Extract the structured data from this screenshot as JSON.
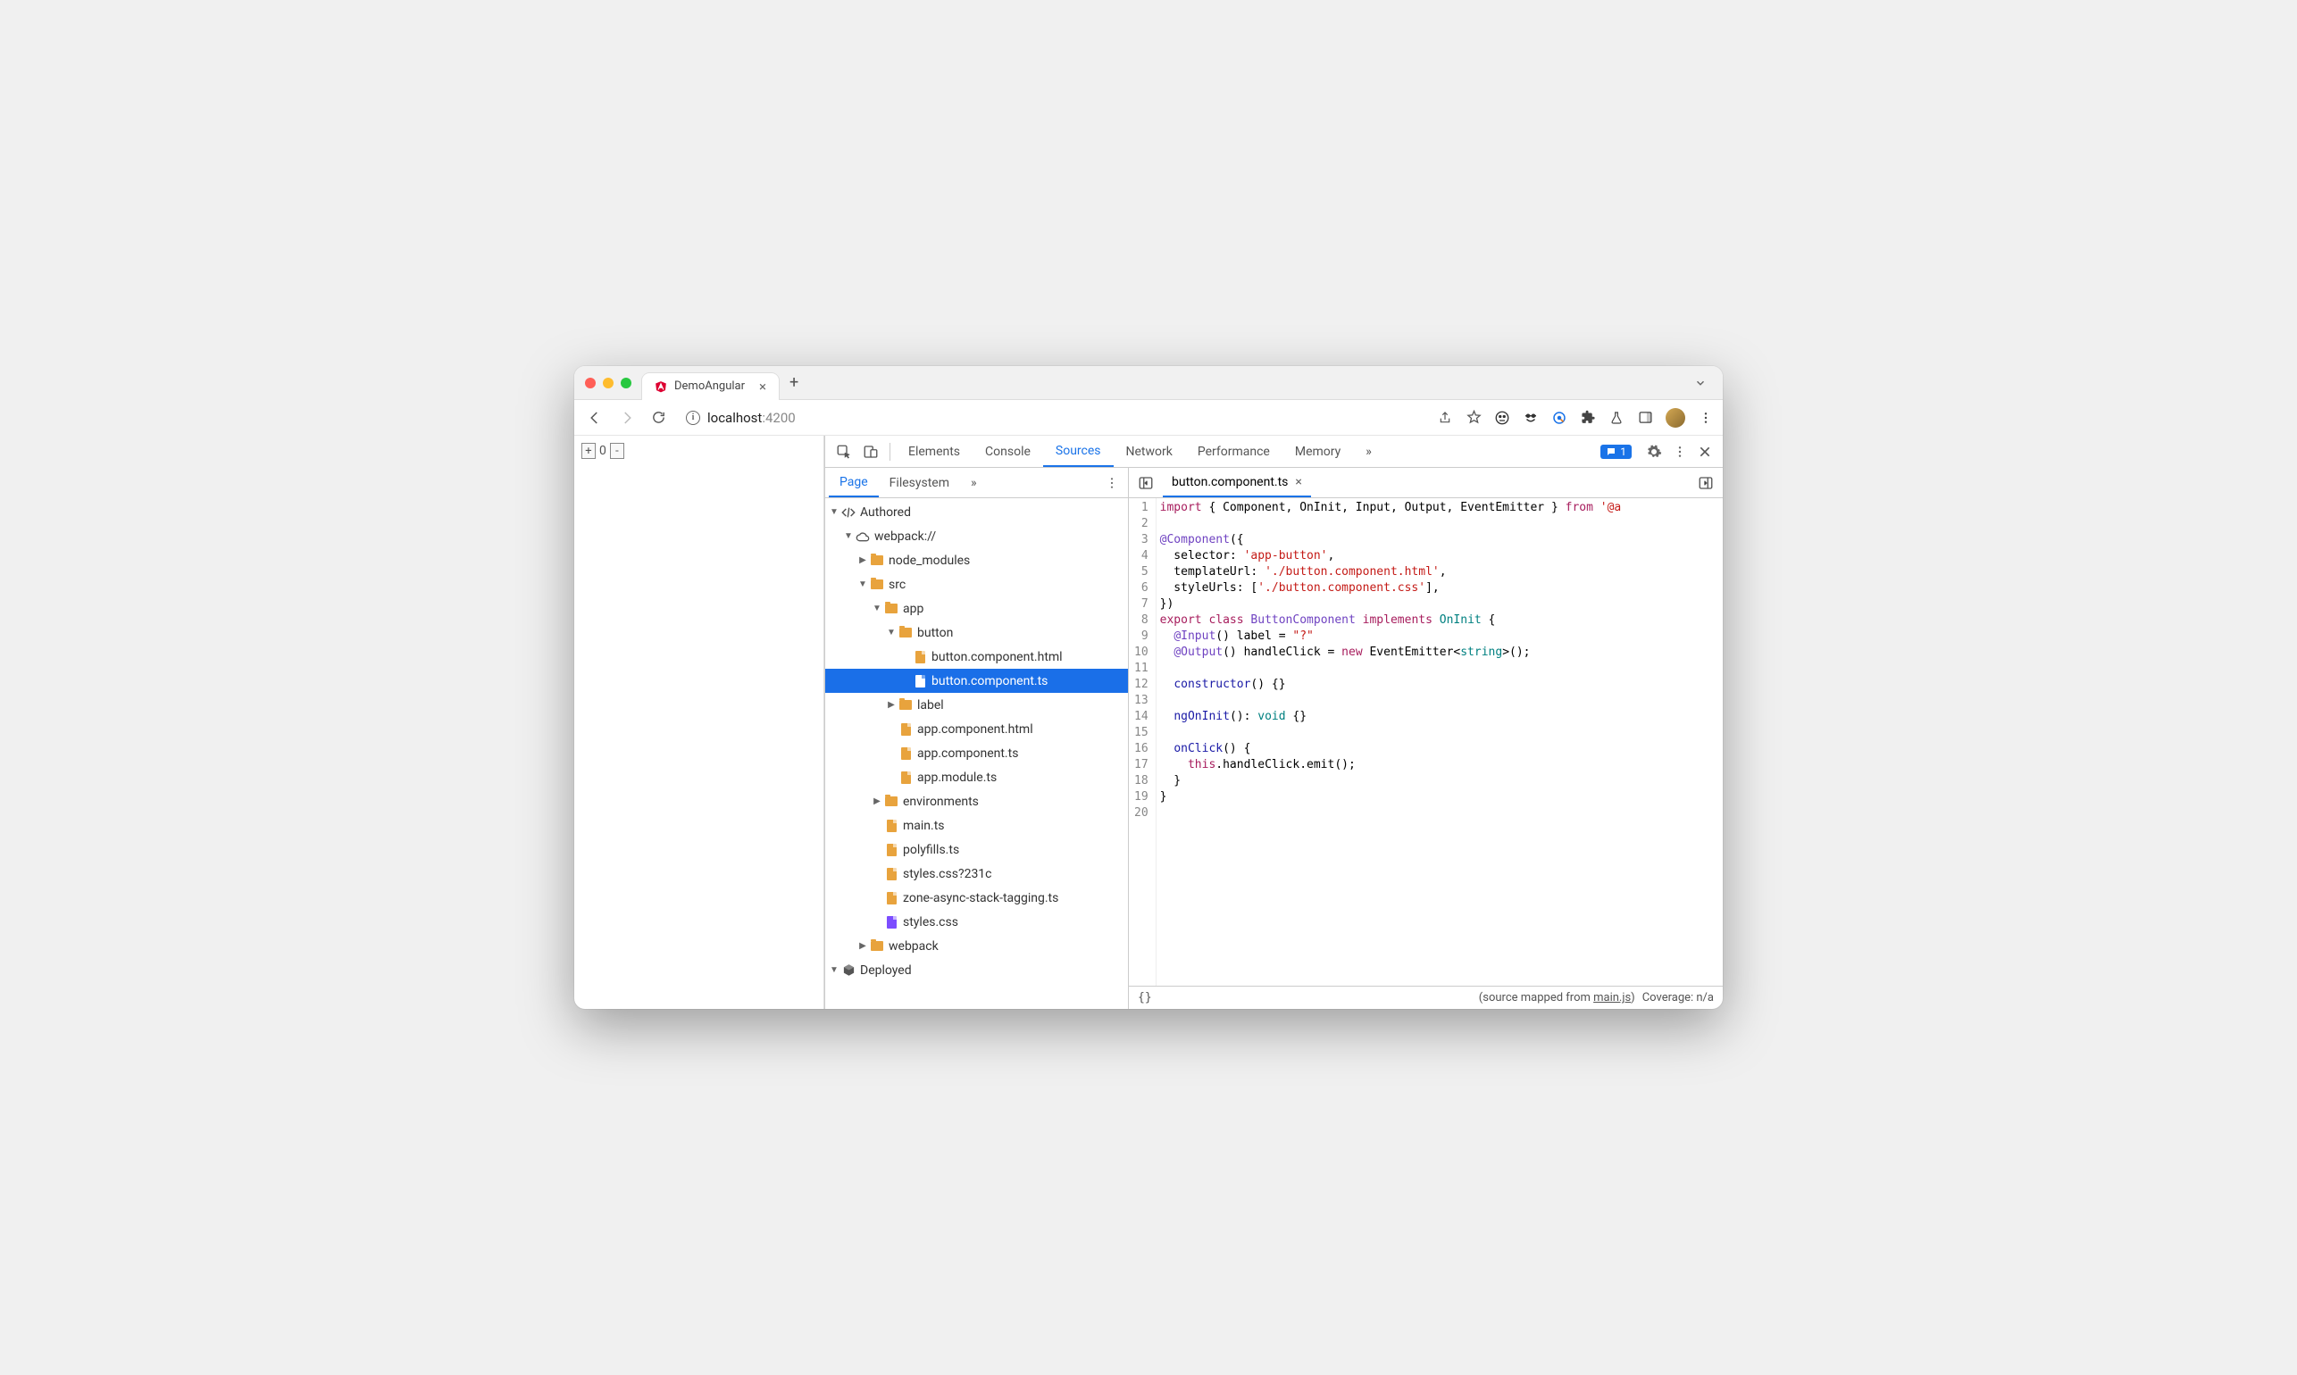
{
  "tab": {
    "title": "DemoAngular"
  },
  "url": {
    "host": "localhost",
    "port": ":4200"
  },
  "counter": {
    "plus": "+",
    "value": "0",
    "minus": "-"
  },
  "devtools": {
    "tabs": [
      "Elements",
      "Console",
      "Sources",
      "Network",
      "Performance",
      "Memory"
    ],
    "more": "»",
    "msg_count": "1"
  },
  "sources": {
    "tabs": [
      "Page",
      "Filesystem"
    ],
    "more": "»"
  },
  "tree": [
    {
      "depth": 0,
      "arrow": "▼",
      "icon": "code",
      "label": "Authored"
    },
    {
      "depth": 1,
      "arrow": "▼",
      "icon": "cloud",
      "label": "webpack://"
    },
    {
      "depth": 2,
      "arrow": "▶",
      "icon": "folder",
      "label": "node_modules"
    },
    {
      "depth": 2,
      "arrow": "▼",
      "icon": "folder",
      "label": "src"
    },
    {
      "depth": 3,
      "arrow": "▼",
      "icon": "folder",
      "label": "app"
    },
    {
      "depth": 4,
      "arrow": "▼",
      "icon": "folder",
      "label": "button"
    },
    {
      "depth": 5,
      "arrow": "",
      "icon": "file",
      "label": "button.component.html"
    },
    {
      "depth": 5,
      "arrow": "",
      "icon": "file",
      "label": "button.component.ts",
      "selected": true
    },
    {
      "depth": 4,
      "arrow": "▶",
      "icon": "folder",
      "label": "label"
    },
    {
      "depth": 4,
      "arrow": "",
      "icon": "file",
      "label": "app.component.html"
    },
    {
      "depth": 4,
      "arrow": "",
      "icon": "file",
      "label": "app.component.ts"
    },
    {
      "depth": 4,
      "arrow": "",
      "icon": "file",
      "label": "app.module.ts"
    },
    {
      "depth": 3,
      "arrow": "▶",
      "icon": "folder",
      "label": "environments"
    },
    {
      "depth": 3,
      "arrow": "",
      "icon": "file",
      "label": "main.ts"
    },
    {
      "depth": 3,
      "arrow": "",
      "icon": "file",
      "label": "polyfills.ts"
    },
    {
      "depth": 3,
      "arrow": "",
      "icon": "file",
      "label": "styles.css?231c"
    },
    {
      "depth": 3,
      "arrow": "",
      "icon": "file",
      "label": "zone-async-stack-tagging.ts"
    },
    {
      "depth": 3,
      "arrow": "",
      "icon": "file-purple",
      "label": "styles.css"
    },
    {
      "depth": 2,
      "arrow": "▶",
      "icon": "folder",
      "label": "webpack"
    },
    {
      "depth": 0,
      "arrow": "▼",
      "icon": "box",
      "label": "Deployed"
    }
  ],
  "editor": {
    "filename": "button.component.ts",
    "lines": [
      {
        "n": 1,
        "tokens": [
          [
            "kw",
            "import"
          ],
          [
            "",
            " { Component, OnInit, Input, Output, EventEmitter } "
          ],
          [
            "kw",
            "from"
          ],
          [
            "",
            " "
          ],
          [
            "str",
            "'@a"
          ]
        ]
      },
      {
        "n": 2,
        "tokens": [
          [
            "",
            ""
          ]
        ]
      },
      {
        "n": 3,
        "tokens": [
          [
            "dec",
            "@Component"
          ],
          [
            "",
            "({"
          ]
        ]
      },
      {
        "n": 4,
        "tokens": [
          [
            "",
            "  selector: "
          ],
          [
            "str",
            "'app-button'"
          ],
          [
            "",
            ","
          ]
        ]
      },
      {
        "n": 5,
        "tokens": [
          [
            "",
            "  templateUrl: "
          ],
          [
            "str",
            "'./button.component.html'"
          ],
          [
            "",
            ","
          ]
        ]
      },
      {
        "n": 6,
        "tokens": [
          [
            "",
            "  styleUrls: ["
          ],
          [
            "str",
            "'./button.component.css'"
          ],
          [
            "",
            "],"
          ]
        ]
      },
      {
        "n": 7,
        "tokens": [
          [
            "",
            "})"
          ]
        ]
      },
      {
        "n": 8,
        "tokens": [
          [
            "kw",
            "export"
          ],
          [
            "",
            " "
          ],
          [
            "kw",
            "class"
          ],
          [
            "",
            " "
          ],
          [
            "cls",
            "ButtonComponent"
          ],
          [
            "",
            " "
          ],
          [
            "impl",
            "implements"
          ],
          [
            "",
            " "
          ],
          [
            "type",
            "OnInit"
          ],
          [
            "",
            " {"
          ]
        ]
      },
      {
        "n": 9,
        "tokens": [
          [
            "",
            "  "
          ],
          [
            "dec",
            "@Input"
          ],
          [
            "",
            "() label = "
          ],
          [
            "str",
            "\"?\""
          ]
        ]
      },
      {
        "n": 10,
        "tokens": [
          [
            "",
            "  "
          ],
          [
            "dec",
            "@Output"
          ],
          [
            "",
            "() handleClick = "
          ],
          [
            "kw",
            "new"
          ],
          [
            "",
            " EventEmitter<"
          ],
          [
            "type",
            "string"
          ],
          [
            "",
            ">();"
          ]
        ]
      },
      {
        "n": 11,
        "tokens": [
          [
            "",
            ""
          ]
        ]
      },
      {
        "n": 12,
        "tokens": [
          [
            "",
            "  "
          ],
          [
            "fn",
            "constructor"
          ],
          [
            "",
            "() {}"
          ]
        ]
      },
      {
        "n": 13,
        "tokens": [
          [
            "",
            ""
          ]
        ]
      },
      {
        "n": 14,
        "tokens": [
          [
            "",
            "  "
          ],
          [
            "fn",
            "ngOnInit"
          ],
          [
            "",
            "(): "
          ],
          [
            "type",
            "void"
          ],
          [
            "",
            " {}"
          ]
        ]
      },
      {
        "n": 15,
        "tokens": [
          [
            "",
            ""
          ]
        ]
      },
      {
        "n": 16,
        "tokens": [
          [
            "",
            "  "
          ],
          [
            "fn",
            "onClick"
          ],
          [
            "",
            "() {"
          ]
        ]
      },
      {
        "n": 17,
        "tokens": [
          [
            "",
            "    "
          ],
          [
            "kw",
            "this"
          ],
          [
            "",
            ".handleClick.emit();"
          ]
        ]
      },
      {
        "n": 18,
        "tokens": [
          [
            "",
            "  }"
          ]
        ]
      },
      {
        "n": 19,
        "tokens": [
          [
            "",
            "}"
          ]
        ]
      },
      {
        "n": 20,
        "tokens": [
          [
            "",
            ""
          ]
        ]
      }
    ]
  },
  "status": {
    "mapped": "(source mapped from ",
    "mapped_link": "main.js",
    "mapped_close": ")",
    "coverage": "Coverage: n/a"
  }
}
